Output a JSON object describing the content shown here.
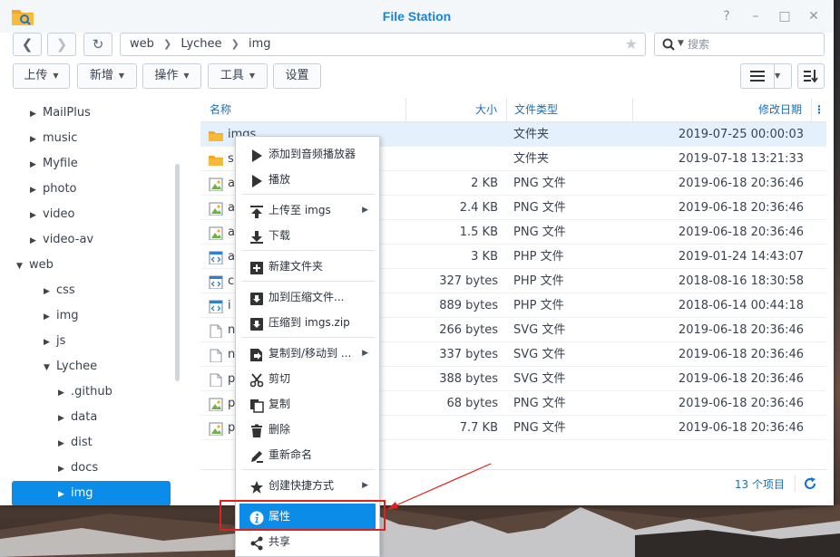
{
  "window": {
    "title": "File Station",
    "help_glyph": "?",
    "minimize_glyph": "–",
    "maximize_glyph": "□",
    "close_glyph": "✕"
  },
  "nav": {
    "back_glyph": "❮",
    "forward_glyph": "❯",
    "refresh_glyph": "↻",
    "path": [
      "web",
      "Lychee",
      "img"
    ],
    "path_separator": "❯",
    "star_glyph": "★",
    "search_placeholder": "搜索"
  },
  "toolbar": {
    "upload": "上传",
    "create": "新增",
    "action": "操作",
    "tools": "工具",
    "settings": "设置",
    "caret": "▼"
  },
  "sidebar": {
    "expanded_glyph": "▼",
    "collapsed_glyph": "▶",
    "items": [
      {
        "label": "MailPlus",
        "expanded": false
      },
      {
        "label": "music",
        "expanded": false
      },
      {
        "label": "Myfile",
        "expanded": false
      },
      {
        "label": "photo",
        "expanded": false
      },
      {
        "label": "video",
        "expanded": false
      },
      {
        "label": "video-av",
        "expanded": false
      },
      {
        "label": "web",
        "expanded": true
      },
      {
        "label": "css",
        "expanded": false
      },
      {
        "label": "img",
        "expanded": false
      },
      {
        "label": "js",
        "expanded": false
      },
      {
        "label": "Lychee",
        "expanded": true
      },
      {
        "label": ".github",
        "expanded": false
      },
      {
        "label": "data",
        "expanded": false
      },
      {
        "label": "dist",
        "expanded": false
      },
      {
        "label": "docs",
        "expanded": false
      },
      {
        "label": "img",
        "expanded": false,
        "selected": true
      }
    ]
  },
  "list": {
    "headers": {
      "name": "名称",
      "size": "大小",
      "type": "文件类型",
      "modified": "修改日期",
      "more": "⋮"
    },
    "rows": [
      {
        "icon": "folder",
        "name": "imgs",
        "size": "",
        "type": "文件夹",
        "modified": "2019-07-25 00:00:03",
        "selected": true
      },
      {
        "icon": "folder",
        "name": "s",
        "size": "",
        "type": "文件夹",
        "modified": "2019-07-18 13:21:33"
      },
      {
        "icon": "image",
        "name": "a",
        "size": "2 KB",
        "type": "PNG 文件",
        "modified": "2019-06-18 20:36:46"
      },
      {
        "icon": "image",
        "name": "a                              u...",
        "size": "2.4 KB",
        "type": "PNG 文件",
        "modified": "2019-06-18 20:36:46"
      },
      {
        "icon": "image",
        "name": "a                              ng",
        "size": "1.5 KB",
        "type": "PNG 文件",
        "modified": "2019-06-18 20:36:46"
      },
      {
        "icon": "code",
        "name": "a",
        "size": "3 KB",
        "type": "PHP 文件",
        "modified": "2019-01-24 14:43:07"
      },
      {
        "icon": "code",
        "name": "c",
        "size": "327 bytes",
        "type": "PHP 文件",
        "modified": "2018-08-16 18:30:58"
      },
      {
        "icon": "code",
        "name": "i",
        "size": "889 bytes",
        "type": "PHP 文件",
        "modified": "2018-06-14 00:44:18"
      },
      {
        "icon": "doc",
        "name": "n",
        "size": "266 bytes",
        "type": "SVG 文件",
        "modified": "2019-06-18 20:36:46"
      },
      {
        "icon": "doc",
        "name": "n",
        "size": "337 bytes",
        "type": "SVG 文件",
        "modified": "2019-06-18 20:36:46"
      },
      {
        "icon": "doc",
        "name": "p",
        "size": "388 bytes",
        "type": "SVG 文件",
        "modified": "2019-06-18 20:36:46"
      },
      {
        "icon": "image",
        "name": "p",
        "size": "68 bytes",
        "type": "PNG 文件",
        "modified": "2019-06-18 20:36:46"
      },
      {
        "icon": "image",
        "name": "p",
        "size": "7.7 KB",
        "type": "PNG 文件",
        "modified": "2019-06-18 20:36:46"
      }
    ]
  },
  "status": {
    "count": "13 个项目"
  },
  "context_menu": {
    "submenu_glyph": "▶",
    "items": [
      {
        "label": "添加到音频播放器",
        "icon": "play-icon"
      },
      {
        "label": "播放",
        "icon": "play-icon"
      },
      {
        "label": "上传至 imgs",
        "icon": "upload-icon",
        "submenu": true
      },
      {
        "label": "下载",
        "icon": "download-icon"
      },
      {
        "label": "新建文件夹",
        "icon": "new-folder-icon"
      },
      {
        "label": "加到压缩文件...",
        "icon": "archive-icon"
      },
      {
        "label": "压缩到 imgs.zip",
        "icon": "compress-icon"
      },
      {
        "label": "复制到/移动到 ...",
        "icon": "copy-move-icon",
        "submenu": true
      },
      {
        "label": "剪切",
        "icon": "scissors-icon"
      },
      {
        "label": "复制",
        "icon": "copy-icon"
      },
      {
        "label": "删除",
        "icon": "trash-icon"
      },
      {
        "label": "重新命名",
        "icon": "rename-icon"
      },
      {
        "label": "创建快捷方式",
        "icon": "star-icon",
        "submenu": true
      },
      {
        "label": "属性",
        "icon": "info-icon",
        "highlighted": true
      },
      {
        "label": "共享",
        "icon": "share-icon"
      }
    ]
  },
  "colors": {
    "accent": "#0c8ce9",
    "title": "#1a84d6",
    "header_text": "#1a6fb5",
    "annotation": "#e0201c"
  }
}
